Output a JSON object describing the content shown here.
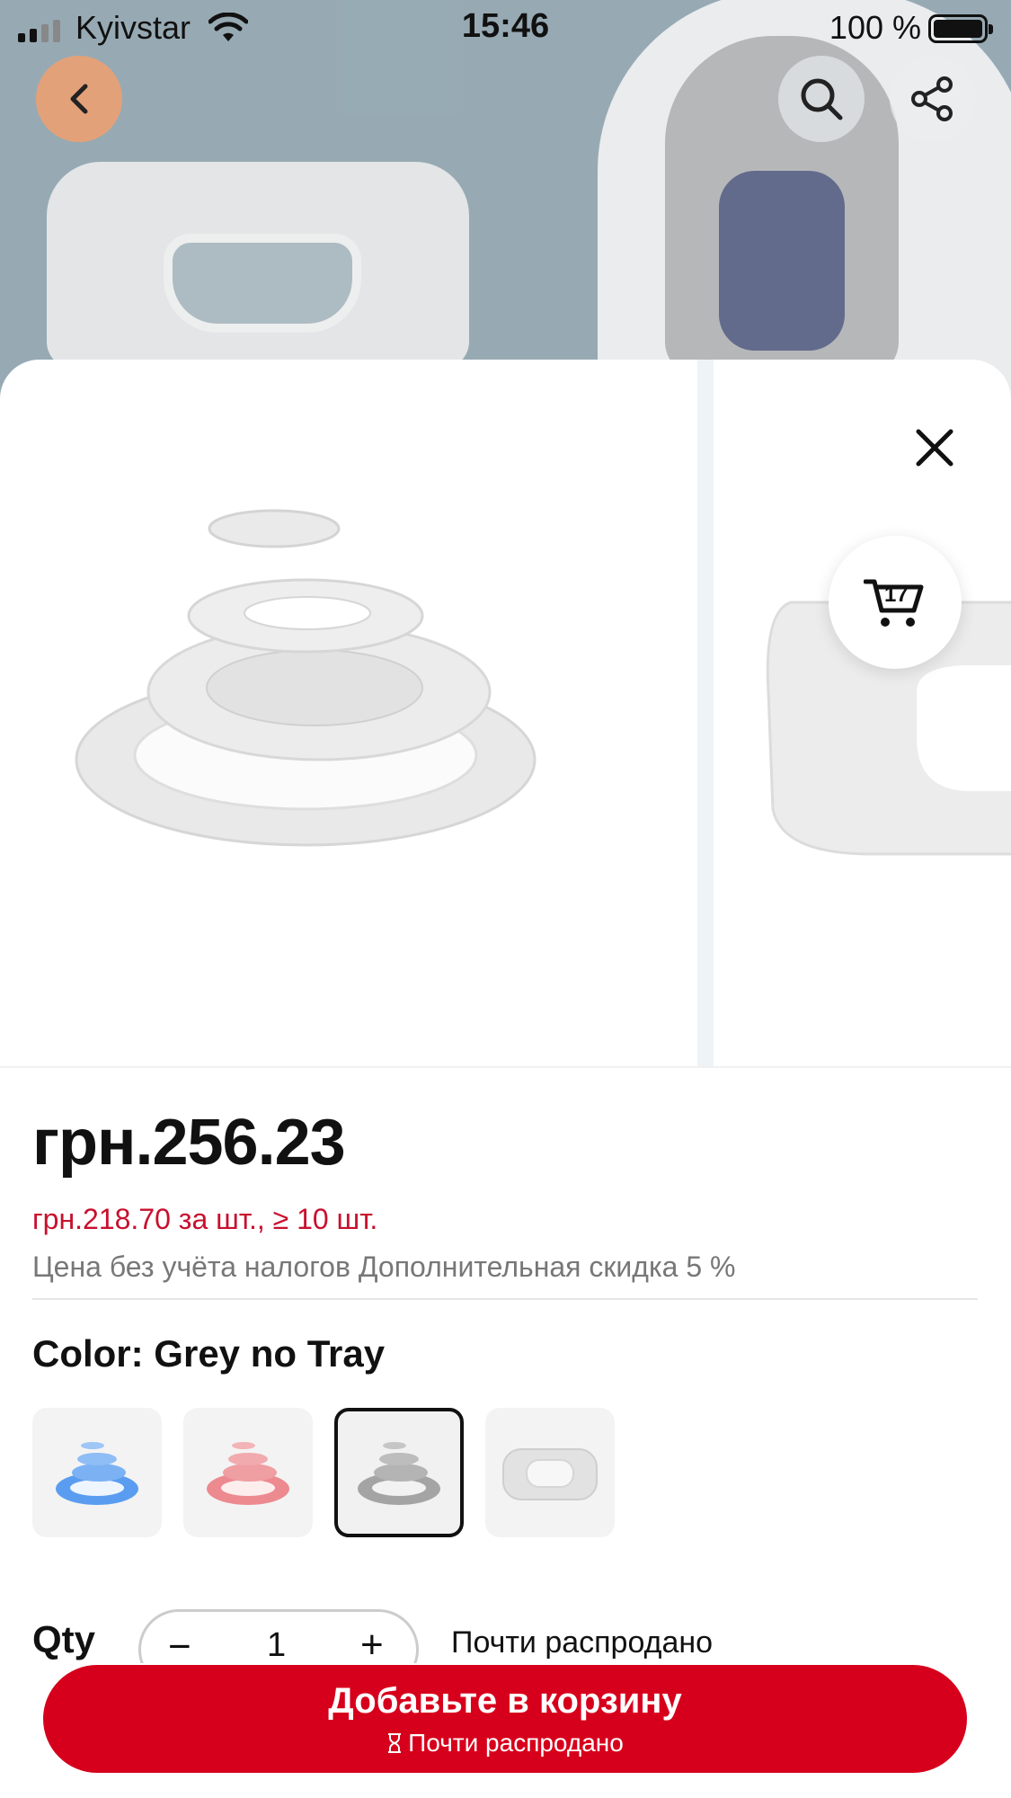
{
  "status_bar": {
    "carrier": "Kyivstar",
    "time": "15:46",
    "battery": "100 %"
  },
  "colors": {
    "accent": "#d7001c",
    "bulk_price": "#c8102e",
    "muted_text": "#777777"
  },
  "icons": {
    "back": "chevron-left-icon",
    "search": "search-icon",
    "share": "share-icon",
    "close": "close-icon",
    "cart": "cart-icon",
    "hourglass": "hourglass-icon"
  },
  "gallery": {
    "cart_count": "17"
  },
  "price": {
    "main": "грн.256.23",
    "bulk": "грн.218.70 за шт., ≥ 10 шт.",
    "tax_note": "Цена без учёта налогов Дополнительная скидка 5 %"
  },
  "color_option": {
    "label": "Color: Grey no Tray",
    "swatches": [
      {
        "name": "blue",
        "tint": "#5a9df0"
      },
      {
        "name": "pink",
        "tint": "#ec8a8f"
      },
      {
        "name": "grey",
        "tint": "#9c9c9c",
        "selected": true
      },
      {
        "name": "white",
        "tint": "#d8d8d8"
      }
    ]
  },
  "quantity": {
    "label": "Qty",
    "minus": "−",
    "value": "1",
    "plus": "+",
    "stock_note": "Почти распродано"
  },
  "cta": {
    "title": "Добавьте в корзину",
    "subtitle": "Почти распродано"
  }
}
